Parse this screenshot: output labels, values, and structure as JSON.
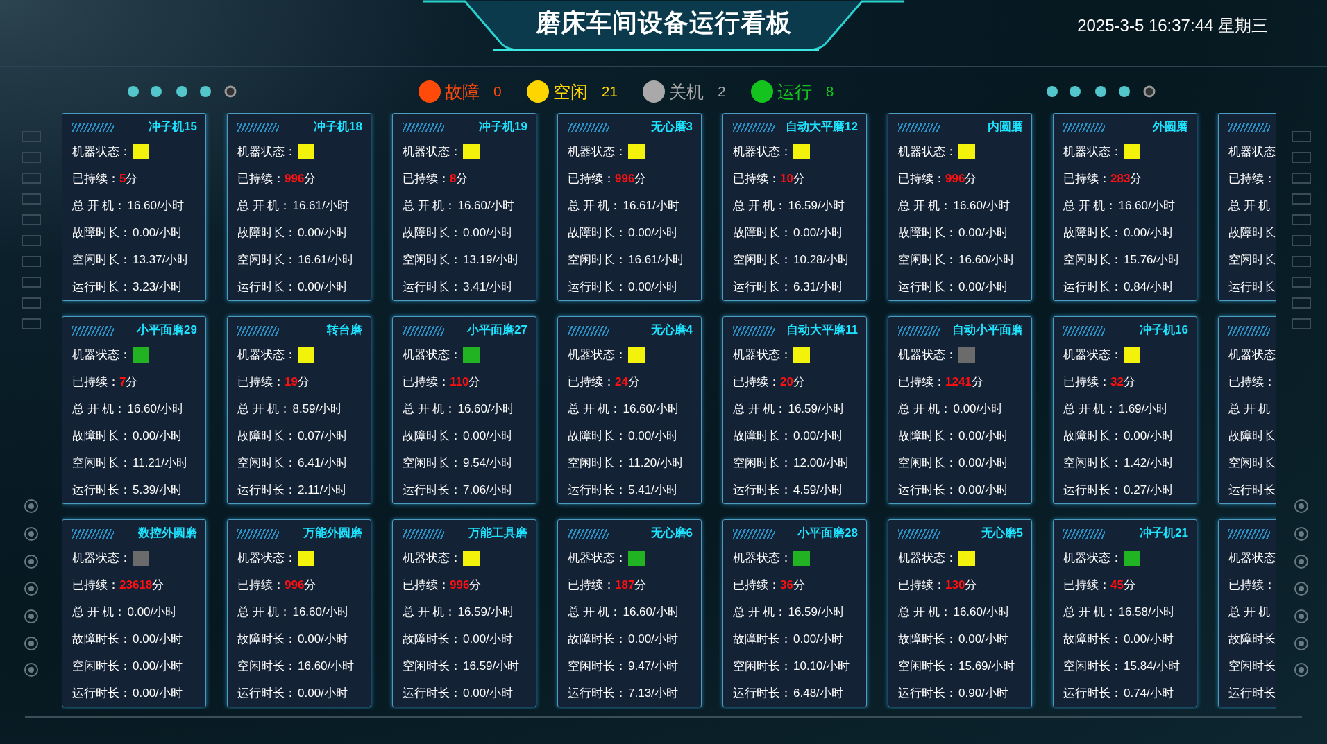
{
  "header": {
    "title": "磨床车间设备运行看板",
    "datetime": "2025-3-5 16:37:44 星期三"
  },
  "legend": [
    {
      "label": "故障",
      "count": "0",
      "color": "#ff4a0a"
    },
    {
      "label": "空闲",
      "count": "21",
      "color": "#ffd500"
    },
    {
      "label": "关机",
      "count": "2",
      "color": "#a9a9a9"
    },
    {
      "label": "运行",
      "count": "8",
      "color": "#14c31e"
    }
  ],
  "cards": [
    {
      "kind": "full",
      "title": "冲子机15",
      "labels": [
        "机器状态：",
        "已持续：",
        "总 开 机：",
        "故障时长：",
        "空闲时长：",
        "运行时长："
      ],
      "color": "#f2f20a",
      "duration": "5",
      "unit": "分",
      "values": [
        "16.60/小时",
        "0.00/小时",
        "13.37/小时",
        "3.23/小时"
      ]
    },
    {
      "kind": "full",
      "title": "冲子机18",
      "labels": [
        "机器状态：",
        "已持续：",
        "总 开 机：",
        "故障时长：",
        "空闲时长：",
        "运行时长："
      ],
      "color": "#f2f20a",
      "duration": "996",
      "unit": "分",
      "values": [
        "16.61/小时",
        "0.00/小时",
        "16.61/小时",
        "0.00/小时"
      ]
    },
    {
      "kind": "full",
      "title": "冲子机19",
      "labels": [
        "机器状态：",
        "已持续：",
        "总 开 机：",
        "故障时长：",
        "空闲时长：",
        "运行时长："
      ],
      "color": "#f2f20a",
      "duration": "8",
      "unit": "分",
      "values": [
        "16.60/小时",
        "0.00/小时",
        "13.19/小时",
        "3.41/小时"
      ]
    },
    {
      "kind": "full",
      "title": "无心磨3",
      "labels": [
        "机器状态：",
        "已持续：",
        "总 开 机：",
        "故障时长：",
        "空闲时长：",
        "运行时长："
      ],
      "color": "#f2f20a",
      "duration": "996",
      "unit": "分",
      "values": [
        "16.61/小时",
        "0.00/小时",
        "16.61/小时",
        "0.00/小时"
      ]
    },
    {
      "kind": "full",
      "title": "自动大平磨12",
      "labels": [
        "机器状态：",
        "已持续：",
        "总 开 机：",
        "故障时长：",
        "空闲时长：",
        "运行时长："
      ],
      "color": "#f2f20a",
      "duration": "10",
      "unit": "分",
      "values": [
        "16.59/小时",
        "0.00/小时",
        "10.28/小时",
        "6.31/小时"
      ]
    },
    {
      "kind": "full",
      "title": "内圆磨",
      "labels": [
        "机器状态：",
        "已持续：",
        "总 开 机：",
        "故障时长：",
        "空闲时长：",
        "运行时长："
      ],
      "color": "#f2f20a",
      "duration": "996",
      "unit": "分",
      "values": [
        "16.60/小时",
        "0.00/小时",
        "16.60/小时",
        "0.00/小时"
      ]
    },
    {
      "kind": "full",
      "title": "外圆磨",
      "labels": [
        "机器状态：",
        "已持续：",
        "总 开 机：",
        "故障时长：",
        "空闲时长：",
        "运行时长："
      ],
      "color": "#f2f20a",
      "duration": "283",
      "unit": "分",
      "values": [
        "16.60/小时",
        "0.00/小时",
        "15.76/小时",
        "0.84/小时"
      ]
    },
    {
      "kind": "partial",
      "labels": [
        "机器状态",
        "已持续：",
        "总 开 机",
        "故障时长",
        "空闲时长",
        "运行时长"
      ]
    },
    {
      "kind": "full",
      "title": "小平面磨29",
      "labels": [
        "机器状态：",
        "已持续：",
        "总 开 机：",
        "故障时长：",
        "空闲时长：",
        "运行时长："
      ],
      "color": "#22b322",
      "duration": "7",
      "unit": "分",
      "values": [
        "16.60/小时",
        "0.00/小时",
        "11.21/小时",
        "5.39/小时"
      ]
    },
    {
      "kind": "full",
      "title": "转台磨",
      "labels": [
        "机器状态：",
        "已持续：",
        "总 开 机：",
        "故障时长：",
        "空闲时长：",
        "运行时长："
      ],
      "color": "#f2f20a",
      "duration": "19",
      "unit": "分",
      "values": [
        "8.59/小时",
        "0.07/小时",
        "6.41/小时",
        "2.11/小时"
      ]
    },
    {
      "kind": "full",
      "title": "小平面磨27",
      "labels": [
        "机器状态：",
        "已持续：",
        "总 开 机：",
        "故障时长：",
        "空闲时长：",
        "运行时长："
      ],
      "color": "#22b322",
      "duration": "110",
      "unit": "分",
      "values": [
        "16.60/小时",
        "0.00/小时",
        "9.54/小时",
        "7.06/小时"
      ]
    },
    {
      "kind": "full",
      "title": "无心磨4",
      "labels": [
        "机器状态：",
        "已持续：",
        "总 开 机：",
        "故障时长：",
        "空闲时长：",
        "运行时长："
      ],
      "color": "#f2f20a",
      "duration": "24",
      "unit": "分",
      "values": [
        "16.60/小时",
        "0.00/小时",
        "11.20/小时",
        "5.41/小时"
      ]
    },
    {
      "kind": "full",
      "title": "自动大平磨11",
      "labels": [
        "机器状态：",
        "已持续：",
        "总 开 机：",
        "故障时长：",
        "空闲时长：",
        "运行时长："
      ],
      "color": "#f2f20a",
      "duration": "20",
      "unit": "分",
      "values": [
        "16.59/小时",
        "0.00/小时",
        "12.00/小时",
        "4.59/小时"
      ]
    },
    {
      "kind": "full",
      "title": "自动小平面磨",
      "labels": [
        "机器状态：",
        "已持续：",
        "总 开 机：",
        "故障时长：",
        "空闲时长：",
        "运行时长："
      ],
      "color": "#6b6b6b",
      "duration": "1241",
      "unit": "分",
      "values": [
        "0.00/小时",
        "0.00/小时",
        "0.00/小时",
        "0.00/小时"
      ]
    },
    {
      "kind": "full",
      "title": "冲子机16",
      "labels": [
        "机器状态：",
        "已持续：",
        "总 开 机：",
        "故障时长：",
        "空闲时长：",
        "运行时长："
      ],
      "color": "#f2f20a",
      "duration": "32",
      "unit": "分",
      "values": [
        "1.69/小时",
        "0.00/小时",
        "1.42/小时",
        "0.27/小时"
      ]
    },
    {
      "kind": "partial",
      "labels": [
        "机器状态",
        "已持续：",
        "总 开 机",
        "故障时长",
        "空闲时长",
        "运行时长"
      ]
    },
    {
      "kind": "full",
      "title": "数控外圆磨",
      "labels": [
        "机器状态：",
        "已持续：",
        "总 开 机：",
        "故障时长：",
        "空闲时长：",
        "运行时长："
      ],
      "color": "#6b6b6b",
      "duration": "23618",
      "unit": "分",
      "values": [
        "0.00/小时",
        "0.00/小时",
        "0.00/小时",
        "0.00/小时"
      ]
    },
    {
      "kind": "full",
      "title": "万能外圆磨",
      "labels": [
        "机器状态：",
        "已持续：",
        "总 开 机：",
        "故障时长：",
        "空闲时长：",
        "运行时长："
      ],
      "color": "#f2f20a",
      "duration": "996",
      "unit": "分",
      "values": [
        "16.60/小时",
        "0.00/小时",
        "16.60/小时",
        "0.00/小时"
      ]
    },
    {
      "kind": "full",
      "title": "万能工具磨",
      "labels": [
        "机器状态：",
        "已持续：",
        "总 开 机：",
        "故障时长：",
        "空闲时长：",
        "运行时长："
      ],
      "color": "#f2f20a",
      "duration": "996",
      "unit": "分",
      "values": [
        "16.59/小时",
        "0.00/小时",
        "16.59/小时",
        "0.00/小时"
      ]
    },
    {
      "kind": "full",
      "title": "无心磨6",
      "labels": [
        "机器状态：",
        "已持续：",
        "总 开 机：",
        "故障时长：",
        "空闲时长：",
        "运行时长："
      ],
      "color": "#22b322",
      "duration": "187",
      "unit": "分",
      "values": [
        "16.60/小时",
        "0.00/小时",
        "9.47/小时",
        "7.13/小时"
      ]
    },
    {
      "kind": "full",
      "title": "小平面磨28",
      "labels": [
        "机器状态：",
        "已持续：",
        "总 开 机：",
        "故障时长：",
        "空闲时长：",
        "运行时长："
      ],
      "color": "#22b322",
      "duration": "36",
      "unit": "分",
      "values": [
        "16.59/小时",
        "0.00/小时",
        "10.10/小时",
        "6.48/小时"
      ]
    },
    {
      "kind": "full",
      "title": "无心磨5",
      "labels": [
        "机器状态：",
        "已持续：",
        "总 开 机：",
        "故障时长：",
        "空闲时长：",
        "运行时长："
      ],
      "color": "#f2f20a",
      "duration": "130",
      "unit": "分",
      "values": [
        "16.60/小时",
        "0.00/小时",
        "15.69/小时",
        "0.90/小时"
      ]
    },
    {
      "kind": "full",
      "title": "冲子机21",
      "labels": [
        "机器状态：",
        "已持续：",
        "总 开 机：",
        "故障时长：",
        "空闲时长：",
        "运行时长："
      ],
      "color": "#22b322",
      "duration": "45",
      "unit": "分",
      "values": [
        "16.58/小时",
        "0.00/小时",
        "15.84/小时",
        "0.74/小时"
      ]
    },
    {
      "kind": "partial",
      "labels": [
        "机器状态",
        "已持续：",
        "总 开 机",
        "故障时长",
        "空闲时长",
        "运行时长"
      ]
    }
  ]
}
